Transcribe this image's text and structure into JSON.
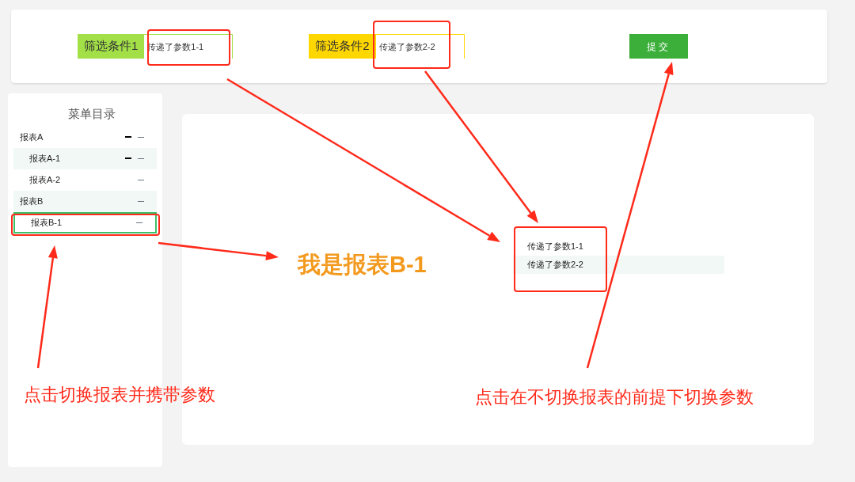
{
  "filters": [
    {
      "label": "筛选条件1",
      "color": "#a3e048",
      "value": "传递了参数1-1"
    },
    {
      "label": "筛选条件2",
      "color": "#ffd700",
      "value": "传递了参数2-2"
    }
  ],
  "submit_button": "提交",
  "menu": {
    "title": "菜单目录",
    "items": [
      {
        "label": "报表A",
        "kind": "double",
        "selected": false,
        "children": [
          {
            "label": "报表A-1",
            "kind": "double",
            "selected": false
          },
          {
            "label": "报表A-2",
            "kind": "single",
            "selected": false
          }
        ]
      },
      {
        "label": "报表B",
        "kind": "single",
        "selected": false,
        "children": [
          {
            "label": "报表B-1",
            "kind": "single",
            "selected": true
          }
        ]
      }
    ]
  },
  "report": {
    "title": "我是报表B-1",
    "params": [
      "传递了参数1-1",
      "传递了参数2-2"
    ]
  },
  "annotations": [
    "点击切换报表并携带参数",
    "点击在不切换报表的前提下切换参数"
  ]
}
